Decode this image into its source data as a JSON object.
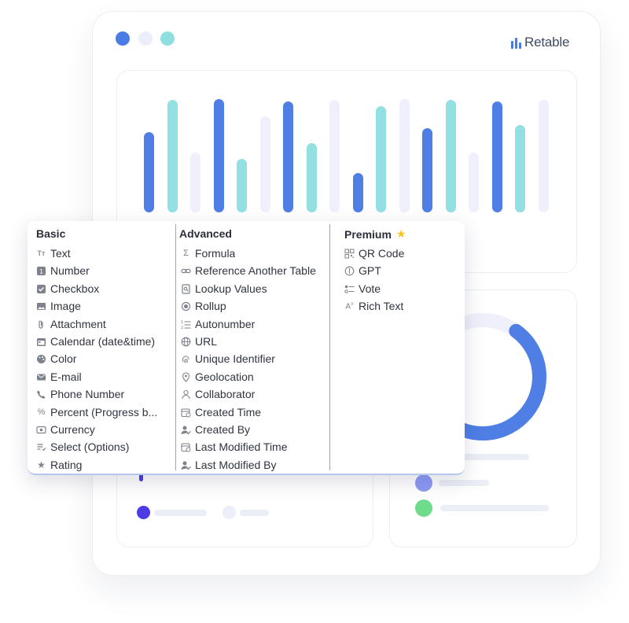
{
  "brand": {
    "name": "Retable"
  },
  "window_controls": [
    {
      "name": "dot-blue",
      "color": "#4b7be5"
    },
    {
      "name": "dot-lavender",
      "color": "#eceefa"
    },
    {
      "name": "dot-teal",
      "color": "#90dfe0"
    }
  ],
  "bar_chart": {
    "colors": [
      "#4f7ee5",
      "#93e0e2",
      "#eff0fb"
    ],
    "bars": [
      {
        "level": 0.71,
        "color": 0
      },
      {
        "level": 0.99,
        "color": 1
      },
      {
        "level": 0.53,
        "color": 2
      },
      {
        "level": 1.0,
        "color": 0
      },
      {
        "level": 0.47,
        "color": 1
      },
      {
        "level": 0.85,
        "color": 2
      },
      {
        "level": 0.98,
        "color": 0
      },
      {
        "level": 0.61,
        "color": 1
      },
      {
        "level": 0.99,
        "color": 2
      },
      {
        "level": 0.35,
        "color": 0
      },
      {
        "level": 0.94,
        "color": 1
      },
      {
        "level": 1.0,
        "color": 2
      },
      {
        "level": 0.74,
        "color": 0
      },
      {
        "level": 0.99,
        "color": 1
      },
      {
        "level": 0.53,
        "color": 2
      },
      {
        "level": 0.98,
        "color": 0
      },
      {
        "level": 0.77,
        "color": 1
      },
      {
        "level": 0.99,
        "color": 2
      }
    ]
  },
  "donut_chart": {
    "progress": 0.62,
    "color": "#4f7ee5",
    "track_color": "#eff0fb"
  },
  "legend_right": [
    {
      "color": "#8d9af4"
    },
    {
      "color": "#6fdc8c"
    }
  ],
  "legend_left": [
    {
      "color": "#4d3ce6"
    },
    {
      "color": "#eceefa"
    }
  ],
  "field_menu": {
    "columns": [
      {
        "title": "Basic",
        "items": [
          {
            "icon": "text-icon",
            "label": "Text"
          },
          {
            "icon": "number-icon",
            "label": "Number"
          },
          {
            "icon": "checkbox-icon",
            "label": "Checkbox"
          },
          {
            "icon": "image-icon",
            "label": "Image"
          },
          {
            "icon": "paperclip-icon",
            "label": "Attachment"
          },
          {
            "icon": "calendar-icon",
            "label": "Calendar (date&time)"
          },
          {
            "icon": "palette-icon",
            "label": "Color"
          },
          {
            "icon": "mail-icon",
            "label": "E-mail"
          },
          {
            "icon": "phone-icon",
            "label": "Phone Number"
          },
          {
            "icon": "percent-icon",
            "label": "Percent (Progress b..."
          },
          {
            "icon": "currency-icon",
            "label": "Currency"
          },
          {
            "icon": "select-icon",
            "label": "Select (Options)"
          },
          {
            "icon": "star-icon",
            "label": "Rating"
          }
        ]
      },
      {
        "title": "Advanced",
        "items": [
          {
            "icon": "sigma-icon",
            "label": "Formula"
          },
          {
            "icon": "link-icon",
            "label": "Reference Another Table"
          },
          {
            "icon": "lookup-icon",
            "label": "Lookup Values"
          },
          {
            "icon": "rollup-icon",
            "label": "Rollup"
          },
          {
            "icon": "autonumber-icon",
            "label": "Autonumber"
          },
          {
            "icon": "globe-icon",
            "label": "URL"
          },
          {
            "icon": "fingerprint-icon",
            "label": "Unique Identifier"
          },
          {
            "icon": "map-pin-icon",
            "label": "Geolocation"
          },
          {
            "icon": "user-icon",
            "label": "Collaborator"
          },
          {
            "icon": "calendar-clock-icon",
            "label": "Created Time"
          },
          {
            "icon": "user-check-icon",
            "label": "Created By"
          },
          {
            "icon": "calendar-clock-icon",
            "label": "Last Modified Time"
          },
          {
            "icon": "user-check-icon",
            "label": "Last Modified By"
          }
        ]
      },
      {
        "title": "Premium",
        "title_icon": "star-icon",
        "items": [
          {
            "icon": "qr-code-icon",
            "label": "QR Code"
          },
          {
            "icon": "gpt-icon",
            "label": "GPT"
          },
          {
            "icon": "vote-icon",
            "label": "Vote"
          },
          {
            "icon": "rich-text-icon",
            "label": "Rich Text"
          }
        ]
      }
    ]
  }
}
